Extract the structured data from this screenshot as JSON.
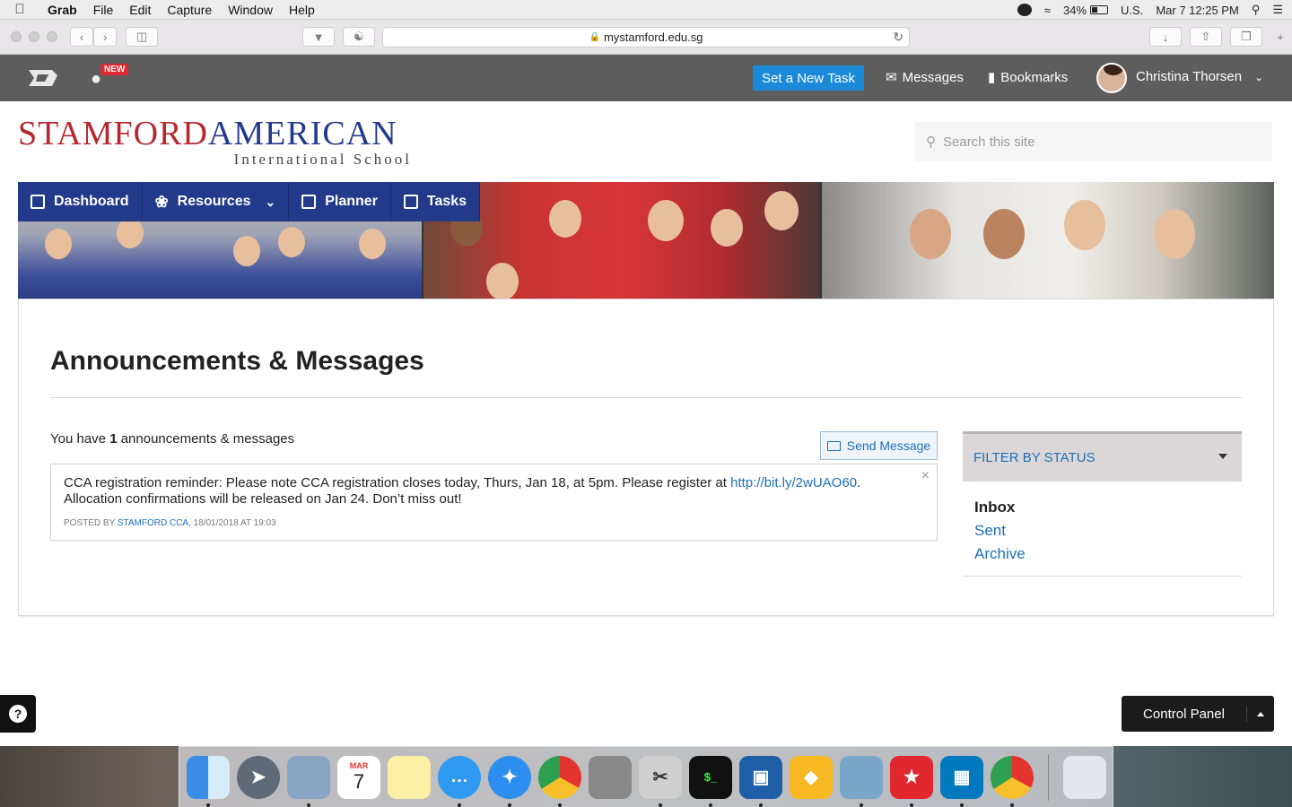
{
  "menubar": {
    "app_name": "Grab",
    "items": [
      "File",
      "Edit",
      "Capture",
      "Window",
      "Help"
    ],
    "battery": "34%",
    "input_source": "U.S.",
    "datetime": "Mar 7  12:25 PM"
  },
  "browser": {
    "url": "mystamford.edu.sg"
  },
  "topbar": {
    "new_badge": "NEW",
    "set_task_label": "Set a New Task",
    "messages_label": "Messages",
    "bookmarks_label": "Bookmarks",
    "user_name": "Christina Thorsen"
  },
  "brand": {
    "line1_part1": "STAMFORD",
    "line1_part2": "AMERICAN",
    "line2": "International School"
  },
  "search": {
    "placeholder": "Search this site"
  },
  "nav": {
    "items": [
      {
        "label": "Dashboard",
        "icon": "grid-icon"
      },
      {
        "label": "Resources",
        "icon": "flower-icon"
      },
      {
        "label": "Planner",
        "icon": "calendar-icon"
      },
      {
        "label": "Tasks",
        "icon": "checkbox-icon"
      }
    ]
  },
  "main": {
    "title": "Announcements & Messages",
    "count_prefix": "You have",
    "count_value": "1",
    "count_suffix": "announcements & messages",
    "send_message_label": "Send Message",
    "message": {
      "text_before_link": "CCA registration reminder: Please note CCA registration closes today, Thurs, Jan 18, at 5pm. Please register at ",
      "link": "http://bit.ly/2wUAO60",
      "text_after_link": ". Allocation confirmations will be released on Jan 24. Don’t miss out!",
      "posted_by_prefix": "POSTED BY",
      "posted_by": "STAMFORD CCA",
      "posted_at": ", 18/01/2018 AT 19:03"
    }
  },
  "filter": {
    "heading": "FILTER BY STATUS",
    "items": [
      {
        "label": "Inbox",
        "active": true
      },
      {
        "label": "Sent",
        "active": false
      },
      {
        "label": "Archive",
        "active": false
      }
    ]
  },
  "footer": {
    "control_panel_label": "Control Panel",
    "help_label": "?"
  },
  "dock": {
    "calendar_month": "MAR",
    "calendar_day": "7"
  },
  "colors": {
    "brand_red": "#b8262f",
    "brand_blue": "#233a8b",
    "link_blue": "#1d6fb8",
    "task_button": "#1a8ad8",
    "topbar": "#5d5d5d"
  }
}
